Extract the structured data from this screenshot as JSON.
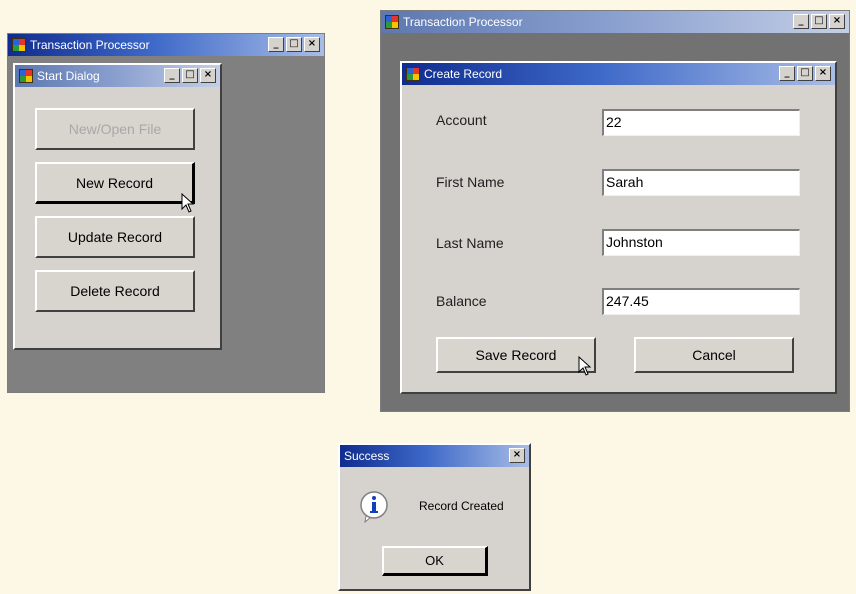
{
  "main_window": {
    "title": "Transaction Processor",
    "minimize": "_",
    "maximize": "□",
    "close": "×"
  },
  "start_dialog": {
    "title": "Start Dialog",
    "minimize": "_",
    "maximize": "□",
    "close": "×",
    "buttons": {
      "new_open_file": "New/Open File",
      "new_record": "New Record",
      "update_record": "Update Record",
      "delete_record": "Delete Record"
    }
  },
  "processor_window": {
    "title": "Transaction Processor",
    "minimize": "_",
    "maximize": "□",
    "close": "×"
  },
  "create_record": {
    "title": "Create Record",
    "minimize": "_",
    "maximize": "□",
    "close": "×",
    "fields": {
      "account_label": "Account",
      "account_value": "22",
      "first_name_label": "First Name",
      "first_name_value": "Sarah",
      "last_name_label": "Last Name",
      "last_name_value": "Johnston",
      "balance_label": "Balance",
      "balance_value": "247.45"
    },
    "buttons": {
      "save": "Save Record",
      "cancel": "Cancel"
    }
  },
  "success_dialog": {
    "title": "Success",
    "close": "×",
    "message": "Record Created",
    "ok": "OK",
    "icon": "info-icon"
  }
}
